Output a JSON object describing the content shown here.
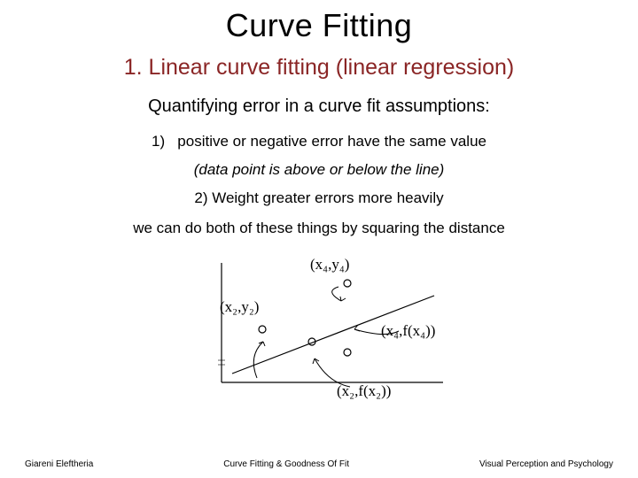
{
  "title": "Curve Fitting",
  "subtitle": "1. Linear curve fitting (linear regression)",
  "line1": "Quantifying error in a curve fit assumptions:",
  "line2": "1)   positive or negative error have the same value",
  "line3": "(data point is above or below the line)",
  "line4": "2) Weight greater errors more heavily",
  "line5": "we can do both of these things by squaring the distance",
  "diagram": {
    "labels": {
      "x4y4": "(x₄,y₄)",
      "x2y2": "(x₂,y₂)",
      "x4f": "(x₄,f(x₄))",
      "x2f": "(x₂,f(x₂))"
    }
  },
  "footer": {
    "left": "Giareni Eleftheria",
    "center": "Curve Fitting & Goodness Of Fit",
    "right": "Visual Perception and Psychology"
  }
}
